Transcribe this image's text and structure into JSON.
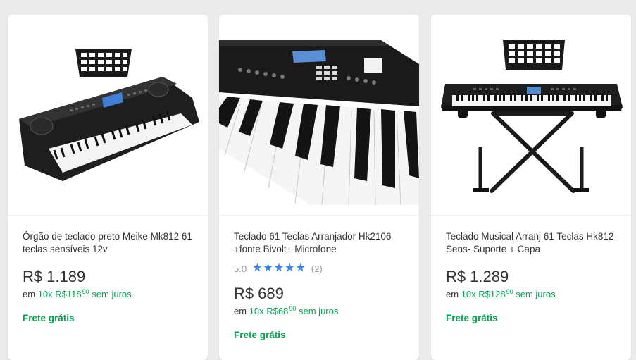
{
  "colors": {
    "green": "#00a650",
    "star_blue": "#3483fa",
    "text": "#333333",
    "muted": "#999999",
    "background": "#ebebeb"
  },
  "products": [
    {
      "image_icon": "keyboard-icon",
      "title": "Órgão de teclado preto Meike Mk812 61 teclas sensíveis 12v",
      "currency": "R$",
      "price": "1.189",
      "installments_prefix": "em",
      "installments_count": "10x",
      "installment_currency": "R$",
      "installment_value": "118",
      "installment_cents": "90",
      "installments_suffix": "sem juros",
      "shipping": "Frete grátis"
    },
    {
      "image_icon": "keyboard-closeup-icon",
      "title": "Teclado 61 Teclas Arranjador Hk2106 +fonte Bivolt+ Microfone",
      "rating": "5.0",
      "stars": 5,
      "review_count": "(2)",
      "currency": "R$",
      "price": "689",
      "installments_prefix": "em",
      "installments_count": "10x",
      "installment_currency": "R$",
      "installment_value": "68",
      "installment_cents": "90",
      "installments_suffix": "sem juros",
      "shipping": "Frete grátis"
    },
    {
      "image_icon": "keyboard-with-stand-icon",
      "title": "Teclado Musical Arranj 61 Teclas Hk812-Sens- Suporte + Capa",
      "currency": "R$",
      "price": "1.289",
      "installments_prefix": "em",
      "installments_count": "10x",
      "installment_currency": "R$",
      "installment_value": "128",
      "installment_cents": "90",
      "installments_suffix": "sem juros",
      "shipping": "Frete grátis"
    }
  ]
}
